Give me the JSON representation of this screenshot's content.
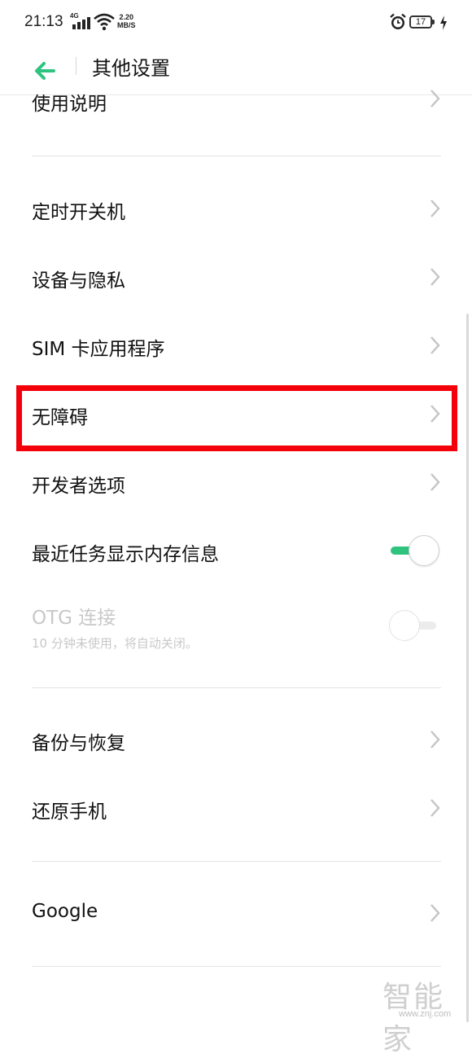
{
  "status_bar": {
    "time": "21:13",
    "network": "4G",
    "speed_value": "2.20",
    "speed_unit": "MB/S",
    "battery": "17"
  },
  "header": {
    "title": "其他设置",
    "back_icon": "back-arrow-icon",
    "accent_color": "#2ec47f"
  },
  "list": {
    "items": [
      {
        "label": "使用说明",
        "type": "link"
      },
      {
        "label": "定时开关机",
        "type": "link"
      },
      {
        "label": "设备与隐私",
        "type": "link"
      },
      {
        "label": "SIM 卡应用程序",
        "type": "link"
      },
      {
        "label": "无障碍",
        "type": "link",
        "highlighted": true
      },
      {
        "label": "开发者选项",
        "type": "link"
      },
      {
        "label": "最近任务显示内存信息",
        "type": "toggle",
        "on": true
      },
      {
        "label": "OTG 连接",
        "type": "toggle",
        "on": false,
        "disabled": true,
        "subtitle": "10 分钟未使用，将自动关闭。"
      },
      {
        "label": "备份与恢复",
        "type": "link"
      },
      {
        "label": "还原手机",
        "type": "link"
      },
      {
        "label": "Google",
        "type": "link"
      }
    ]
  },
  "highlight_color": "#f4000b",
  "watermark": {
    "text": "智能家",
    "url": "www.znj.com"
  }
}
